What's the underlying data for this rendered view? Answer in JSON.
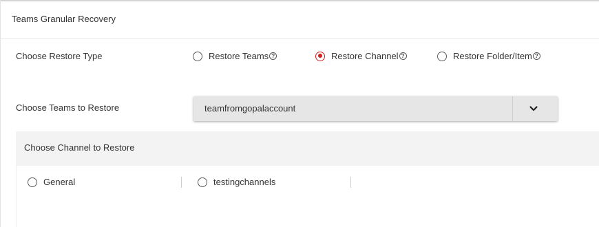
{
  "section": {
    "title": "Teams Granular Recovery"
  },
  "restore_type": {
    "label": "Choose Restore Type",
    "options": [
      {
        "label": "Restore Teams",
        "selected": false,
        "help_icon": "question-circle-icon"
      },
      {
        "label": "Restore Channel",
        "selected": true,
        "help_icon": "question-circle-icon"
      },
      {
        "label": "Restore Folder/Item",
        "selected": false,
        "help_icon": "question-circle-icon"
      }
    ]
  },
  "teams": {
    "label": "Choose Teams to Restore",
    "selected_value": "teamfromgopalaccount",
    "toggle_icon": "chevron-down-icon"
  },
  "channels": {
    "label": "Choose Channel to Restore",
    "options": [
      {
        "label": "General",
        "selected": false
      },
      {
        "label": "testingchannels",
        "selected": false
      }
    ]
  },
  "colors": {
    "accent_red": "#d4201e",
    "dropdown_bg": "#e6e6e6",
    "panel_bg": "#f3f3f3",
    "text": "#333333"
  }
}
